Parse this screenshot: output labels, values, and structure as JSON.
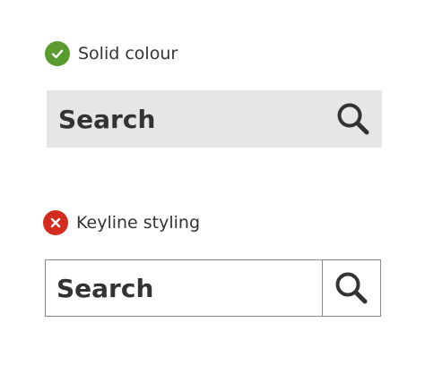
{
  "examples": {
    "good": {
      "label": "Solid colour",
      "status_icon": "check-icon",
      "status_color": "#5a9b2f",
      "search_text": "Search",
      "search_icon": "search-icon",
      "background": "#e6e6e6"
    },
    "bad": {
      "label": "Keyline styling",
      "status_icon": "cross-icon",
      "status_color": "#d42d20",
      "search_text": "Search",
      "search_icon": "search-icon",
      "border_color": "#8a8a8a"
    }
  }
}
